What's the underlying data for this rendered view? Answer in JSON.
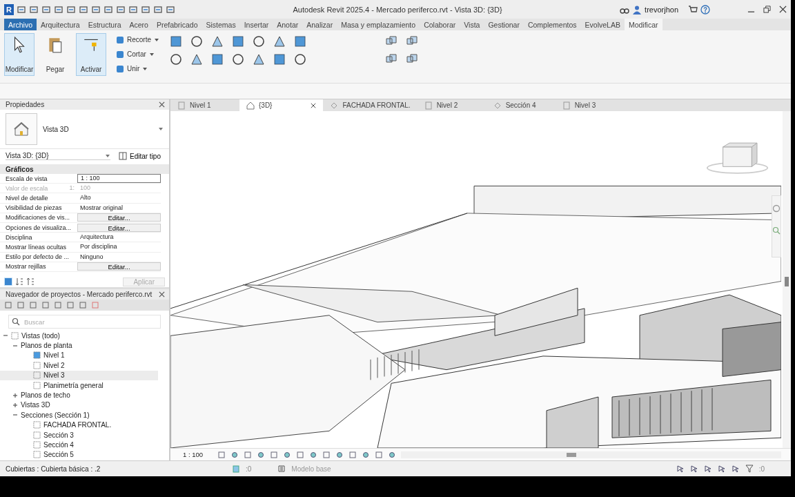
{
  "title_bar": {
    "logo": "R",
    "title": "Autodesk Revit 2025.4 - Mercado periferco.rvt - Vista 3D: {3D}",
    "user": "trevorjhon"
  },
  "ribbon_tabs": [
    {
      "label": "Archivo",
      "kind": "file",
      "selected": false
    },
    {
      "label": "Arquitectura",
      "kind": "tab",
      "selected": false
    },
    {
      "label": "Estructura",
      "kind": "tab",
      "selected": false
    },
    {
      "label": "Acero",
      "kind": "tab",
      "selected": false
    },
    {
      "label": "Prefabricado",
      "kind": "tab",
      "selected": false
    },
    {
      "label": "Sistemas",
      "kind": "tab",
      "selected": false
    },
    {
      "label": "Insertar",
      "kind": "tab",
      "selected": false
    },
    {
      "label": "Anotar",
      "kind": "tab",
      "selected": false
    },
    {
      "label": "Analizar",
      "kind": "tab",
      "selected": false
    },
    {
      "label": "Masa y emplazamiento",
      "kind": "tab",
      "selected": false
    },
    {
      "label": "Colaborar",
      "kind": "tab",
      "selected": false
    },
    {
      "label": "Vista",
      "kind": "tab",
      "selected": false
    },
    {
      "label": "Gestionar",
      "kind": "tab",
      "selected": false
    },
    {
      "label": "Complementos",
      "kind": "tab",
      "selected": false
    },
    {
      "label": "EvolveLAB",
      "kind": "tab",
      "selected": false
    },
    {
      "label": "Modificar",
      "kind": "tab",
      "selected": true
    }
  ],
  "ribbon_tools": [
    {
      "label": "Modificar",
      "selected": true
    },
    {
      "label": "Pegar",
      "selected": false
    },
    {
      "label": "Activar",
      "selected": true
    }
  ],
  "ribbon_small_tools": [
    "Recorte",
    "Cortar",
    "Unir"
  ],
  "properties": {
    "title": "Propiedades",
    "type_name": "Vista 3D",
    "instance": "Vista 3D: {3D}",
    "edit_type": "Editar tipo",
    "group": "Gráficos",
    "rows": [
      {
        "label": "Escala de vista",
        "value": "1 : 100",
        "kind": "field",
        "disabled": false
      },
      {
        "label": "Valor de escala",
        "unit": "1:",
        "value": "100",
        "kind": "text",
        "disabled": true
      },
      {
        "label": "Nivel de detalle",
        "value": "Alto",
        "kind": "text",
        "disabled": false
      },
      {
        "label": "Visibilidad de piezas",
        "value": "Mostrar original",
        "kind": "text",
        "disabled": false
      },
      {
        "label": "Modificaciones de vis...",
        "value": "Editar...",
        "kind": "button",
        "disabled": false
      },
      {
        "label": "Opciones de visualiza...",
        "value": "Editar...",
        "kind": "button",
        "disabled": false
      },
      {
        "label": "Disciplina",
        "value": "Arquitectura",
        "kind": "text",
        "disabled": false
      },
      {
        "label": "Mostrar líneas ocultas",
        "value": "Por disciplina",
        "kind": "text",
        "disabled": false
      },
      {
        "label": "Estilo por defecto de ...",
        "value": "Ninguno",
        "kind": "text",
        "disabled": false
      },
      {
        "label": "Mostrar rejillas",
        "value": "Editar...",
        "kind": "button",
        "disabled": false
      }
    ],
    "apply": "Aplicar"
  },
  "project_browser": {
    "title": "Navegador de proyectos - Mercado periferco.rvt",
    "search_placeholder": "Buscar",
    "tree": [
      {
        "label": "Vistas (todo)",
        "expanded": true,
        "selected": false,
        "children": [
          {
            "label": "Planos de planta",
            "expanded": true,
            "selected": false,
            "children": [
              {
                "label": "Nivel 1",
                "active": true,
                "selected": false
              },
              {
                "label": "Nivel 2",
                "active": false,
                "selected": false
              },
              {
                "label": "Nivel 3",
                "active": false,
                "selected": true
              },
              {
                "label": "Planimetría general",
                "active": false,
                "selected": false
              }
            ]
          },
          {
            "label": "Planos de techo",
            "expanded": false,
            "selected": false
          },
          {
            "label": "Vistas 3D",
            "expanded": false,
            "selected": false
          },
          {
            "label": "Secciones (Sección 1)",
            "expanded": true,
            "selected": false,
            "children": [
              {
                "label": "FACHADA FRONTAL.",
                "active": false,
                "selected": false
              },
              {
                "label": "Sección 3",
                "active": false,
                "selected": false
              },
              {
                "label": "Sección 4",
                "active": false,
                "selected": false
              },
              {
                "label": "Sección 5",
                "active": false,
                "selected": false
              }
            ]
          }
        ]
      }
    ]
  },
  "view_tabs": [
    {
      "label": "Nivel 1",
      "kind": "plan",
      "selected": false
    },
    {
      "label": "{3D}",
      "kind": "perspective",
      "selected": true
    },
    {
      "label": "FACHADA FRONTAL.",
      "kind": "section",
      "selected": false
    },
    {
      "label": "Nivel 2",
      "kind": "plan",
      "selected": false
    },
    {
      "label": "Sección 4",
      "kind": "section",
      "selected": false
    },
    {
      "label": "Nivel 3",
      "kind": "plan",
      "selected": false
    }
  ],
  "view_control_bar": {
    "scale": "1 : 100"
  },
  "status_bar": {
    "message": "Cubiertas : Cubierta básica : .2",
    "worksets_count": ":0",
    "design_option": "Modelo base",
    "filter_count": ":0"
  }
}
